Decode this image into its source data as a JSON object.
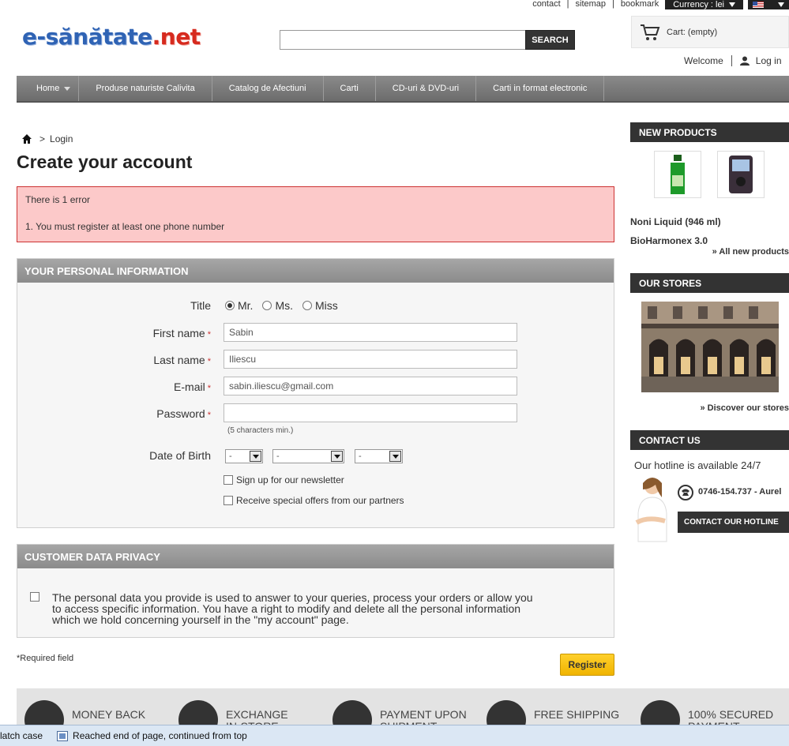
{
  "toplinks": {
    "contact": "contact",
    "sitemap": "sitemap",
    "bookmark": "bookmark",
    "currency": "Currency : lei"
  },
  "logo": {
    "part1": "e-sănătate",
    "part2": ".net"
  },
  "search": {
    "placeholder": "",
    "button": "SEARCH"
  },
  "cart": {
    "label": "Cart:",
    "status": "(empty)"
  },
  "user": {
    "welcome": "Welcome",
    "login": "Log in"
  },
  "nav": {
    "items": [
      {
        "label": "Home",
        "dropdown": true
      },
      {
        "label": "Produse naturiste Calivita"
      },
      {
        "label": "Catalog de Afectiuni"
      },
      {
        "label": "Carti"
      },
      {
        "label": "CD-uri & DVD-uri"
      },
      {
        "label": "Carti in format electronic"
      }
    ]
  },
  "breadcrumb": {
    "sep": ">",
    "current": "Login"
  },
  "page": {
    "title": "Create your account"
  },
  "error": {
    "heading": "There is 1 error",
    "items": [
      "1.  You must register at least one phone number"
    ]
  },
  "personal": {
    "heading": "YOUR PERSONAL INFORMATION",
    "title_label": "Title",
    "title_options": [
      "Mr.",
      "Ms.",
      "Miss"
    ],
    "title_selected": "Mr.",
    "firstname_label": "First name",
    "firstname_value": "Sabin",
    "lastname_label": "Last name",
    "lastname_value": "Iliescu",
    "email_label": "E-mail",
    "email_value": "sabin.iliescu@gmail.com",
    "password_label": "Password",
    "password_value": "",
    "password_hint": "(5 characters min.)",
    "dob_label": "Date of Birth",
    "dob_day": "-",
    "dob_month": "-",
    "dob_year": "-",
    "newsletter": "Sign up for our newsletter",
    "offers": "Receive special offers from our partners",
    "required_mark": "*"
  },
  "privacy": {
    "heading": "CUSTOMER DATA PRIVACY",
    "text": "The personal data you provide is used to answer to your queries, process your orders or allow you to access specific information. You have a right to modify and delete all the personal information which we hold concerning yourself in the \"my account\" page."
  },
  "footer_form": {
    "required": "*Required field",
    "register": "Register"
  },
  "sidebar": {
    "new_products": {
      "heading": "NEW PRODUCTS",
      "items": [
        "Noni Liquid (946 ml)",
        "BioHarmonex 3.0"
      ],
      "all_link": "» All new products"
    },
    "stores": {
      "heading": "OUR STORES",
      "link": "» Discover our stores"
    },
    "contact": {
      "heading": "CONTACT US",
      "hotline_text": "Our hotline is available 24/7",
      "phone": "0746-154.737 - Aurel",
      "button": "CONTACT OUR HOTLINE"
    }
  },
  "reassurance": [
    {
      "line1": "MONEY BACK",
      "line2": ""
    },
    {
      "line1": "EXCHANGE",
      "line2": "IN-STORE"
    },
    {
      "line1": "PAYMENT UPON",
      "line2": "SHIPMENT"
    },
    {
      "line1": "FREE SHIPPING",
      "line2": ""
    },
    {
      "line1": "100% SECURED",
      "line2": "PAYMENT"
    }
  ],
  "findbar": {
    "match_case": "latch case",
    "message": "Reached end of page, continued from top"
  }
}
